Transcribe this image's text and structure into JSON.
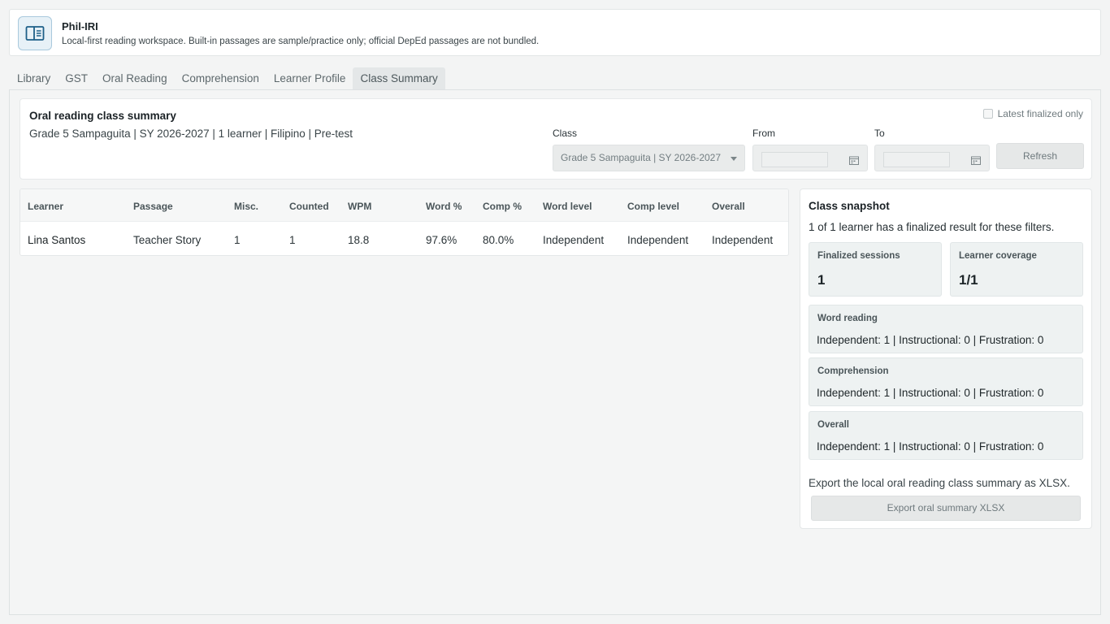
{
  "app": {
    "title": "Phil-IRI",
    "subtitle": "Local-first reading workspace. Built-in passages are sample/practice only; official DepEd passages are not bundled."
  },
  "tabs": [
    {
      "label": "Library",
      "active": false
    },
    {
      "label": "GST",
      "active": false
    },
    {
      "label": "Oral Reading",
      "active": false
    },
    {
      "label": "Comprehension",
      "active": false
    },
    {
      "label": "Learner Profile",
      "active": false
    },
    {
      "label": "Class Summary",
      "active": true
    }
  ],
  "filters": {
    "title": "Oral reading class summary",
    "subtitle": "Grade 5 Sampaguita | SY 2026-2027 | 1 learner | Filipino | Pre-test",
    "latest_label": "Latest finalized only",
    "latest_checked": false,
    "class_label": "Class",
    "class_value": "Grade 5 Sampaguita | SY 2026-2027",
    "from_label": "From",
    "from_value": "",
    "to_label": "To",
    "to_value": "",
    "refresh_label": "Refresh"
  },
  "table": {
    "headers": [
      "Learner",
      "Passage",
      "Misc.",
      "Counted",
      "WPM",
      "Word %",
      "Comp %",
      "Word level",
      "Comp level",
      "Overall"
    ],
    "rows": [
      [
        "Lina Santos",
        "Teacher Story",
        "1",
        "1",
        "18.8",
        "97.6%",
        "80.0%",
        "Independent",
        "Independent",
        "Independent"
      ]
    ]
  },
  "snapshot": {
    "title": "Class snapshot",
    "note": "1 of 1 learner has a finalized result for these filters.",
    "finalized_label": "Finalized sessions",
    "finalized_value": "1",
    "coverage_label": "Learner coverage",
    "coverage_value": "1/1",
    "word_label": "Word reading",
    "word_value": "Independent: 1 | Instructional: 0 | Frustration: 0",
    "comp_label": "Comprehension",
    "comp_value": "Independent: 1 | Instructional: 0 | Frustration: 0",
    "overall_label": "Overall",
    "overall_value": "Independent: 1 | Instructional: 0 | Frustration: 0",
    "export_note": "Export the local oral reading class summary as XLSX.",
    "export_label": "Export oral summary XLSX"
  },
  "colors": {
    "accent": "#2a6f97",
    "icon_bg": "#e7f1f7"
  }
}
